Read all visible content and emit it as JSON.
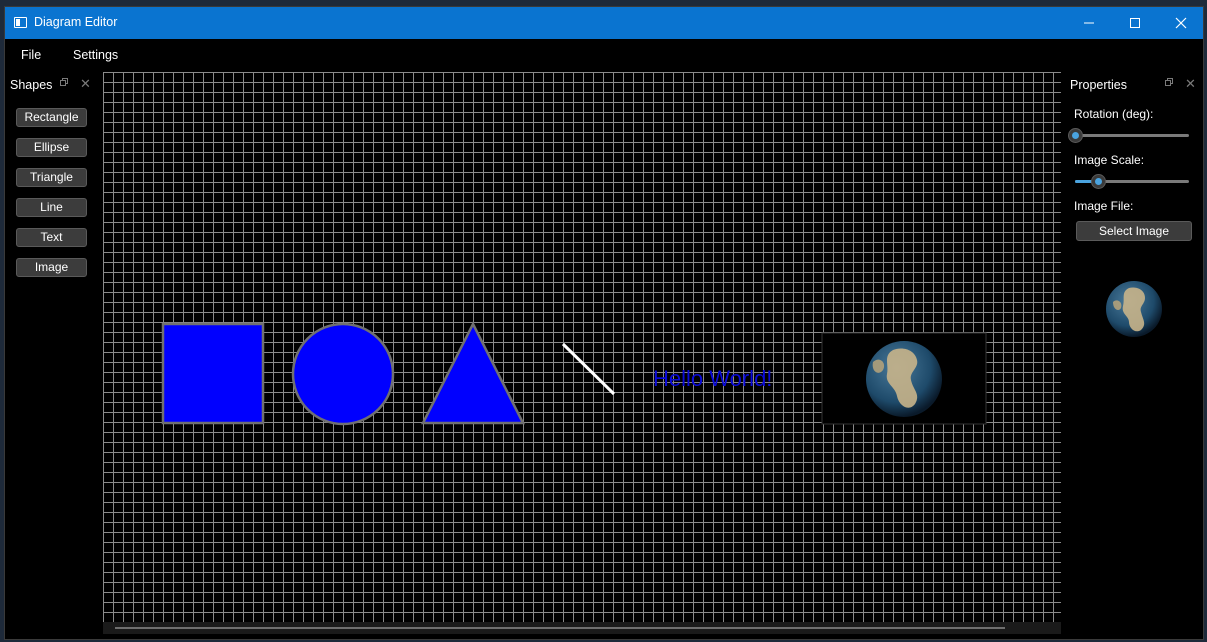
{
  "window": {
    "title": "Diagram Editor"
  },
  "menu": {
    "items": [
      "File",
      "Settings"
    ]
  },
  "shapes_panel": {
    "title": "Shapes",
    "buttons": [
      "Rectangle",
      "Ellipse",
      "Triangle",
      "Line",
      "Text",
      "Image"
    ]
  },
  "canvas": {
    "text_shape": "Hello World!",
    "fill_color": "#0000ff",
    "stroke_color": "#707070",
    "grid_color": "#8a8a8a",
    "icons": [
      "globe-icon"
    ]
  },
  "properties_panel": {
    "title": "Properties",
    "rotation_label": "Rotation (deg):",
    "rotation_fraction": 0.0,
    "scale_label": "Image Scale:",
    "scale_fraction": 0.2,
    "image_file_label": "Image File:",
    "select_image_button": "Select Image",
    "accent_color": "#4aa3df"
  },
  "colors": {
    "titlebar": "#0a74d0",
    "background": "#000000"
  }
}
